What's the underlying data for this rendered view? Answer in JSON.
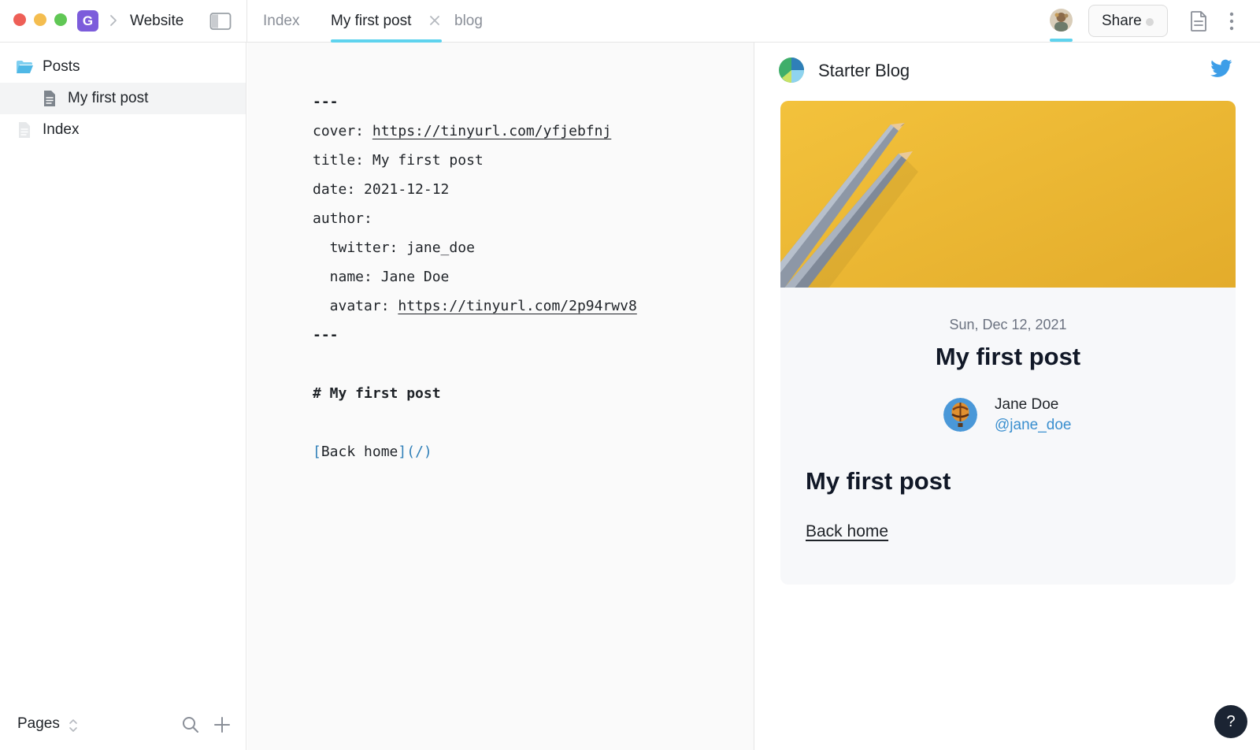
{
  "window": {
    "workspace_initial": "G",
    "workspace_name": "Website"
  },
  "tabs": [
    {
      "label": "Index",
      "active": false
    },
    {
      "label": "My first post",
      "active": true
    },
    {
      "label": "blog",
      "active": false
    }
  ],
  "toolbar": {
    "share_label": "Share",
    "icons": [
      "user-avatar",
      "document-icon",
      "more-vertical-icon"
    ]
  },
  "sidebar": {
    "items": [
      {
        "label": "Posts",
        "icon": "folder-open-icon",
        "level": 0,
        "selected": false
      },
      {
        "label": "My first post",
        "icon": "document-icon",
        "level": 1,
        "selected": true
      },
      {
        "label": "Index",
        "icon": "document-icon",
        "level": 0,
        "selected": false
      }
    ],
    "footer_label": "Pages"
  },
  "editor": {
    "lines": {
      "l1": "---",
      "l2_key": "cover: ",
      "l2_val": "https://tinyurl.com/yfjebfnj",
      "l3": "title: My first post",
      "l4": "date: 2021-12-12",
      "l5": "author:",
      "l6": "  twitter: jane_doe",
      "l7": "  name: Jane Doe",
      "l8_key": "  avatar: ",
      "l8_val": "https://tinyurl.com/2p94rwv8",
      "l9": "---",
      "l10": "",
      "l11": "# My first post",
      "l12": "",
      "l13_open": "[",
      "l13_text": "Back home",
      "l13_close": "](/)"
    }
  },
  "preview": {
    "site_title": "Starter Blog",
    "post_date": "Sun, Dec 12, 2021",
    "post_title": "My first post",
    "author_name": "Jane Doe",
    "author_handle": "@jane_doe",
    "body_heading": "My first post",
    "back_home": "Back home"
  },
  "help_label": "?",
  "colors": {
    "accent_tab": "#5ed3ee",
    "workspace_badge": "#7c5cdb",
    "link_blue": "#3a8fcf",
    "cover_yellow": "#f0bd3a"
  }
}
